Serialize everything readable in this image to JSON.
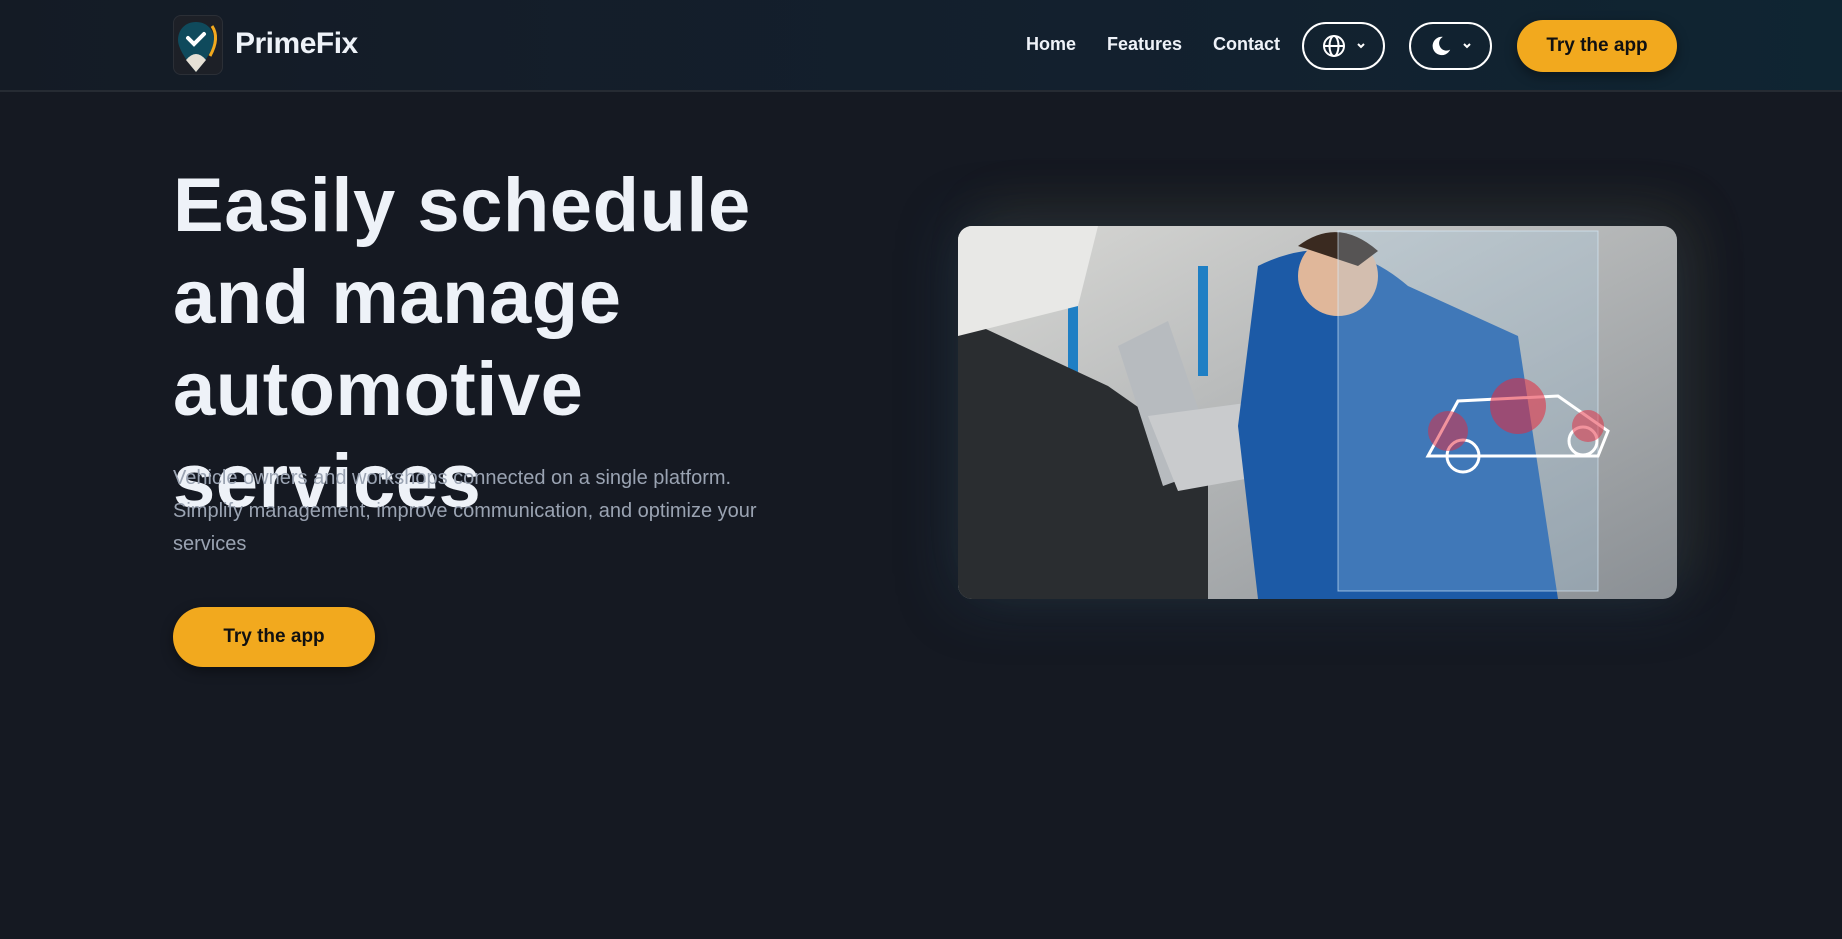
{
  "header": {
    "brand": "PrimeFix",
    "nav": [
      {
        "label": "Home"
      },
      {
        "label": "Features"
      },
      {
        "label": "Contact"
      }
    ],
    "language_icon": "globe-icon",
    "theme_icon": "moon-icon",
    "cta_label": "Try the app"
  },
  "hero": {
    "title": "Easily schedule and manage automotive services",
    "subtitle": "Vehicle owners and workshops connected on a single platform. Simplify management, improve communication, and optimize your services",
    "cta_label": "Try the app"
  },
  "colors": {
    "accent": "#f2a91e",
    "background": "#151922",
    "logo_teal": "#0f4a5c"
  }
}
